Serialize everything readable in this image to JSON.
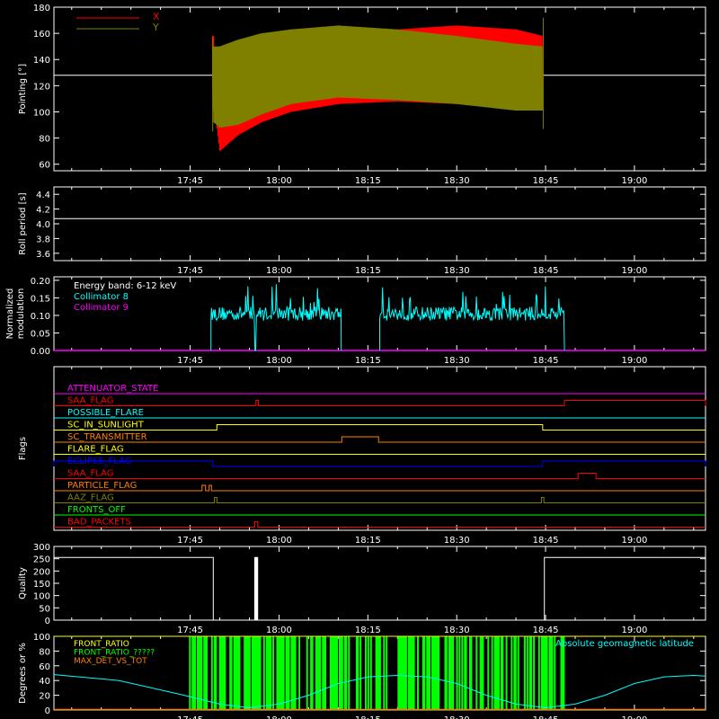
{
  "x_axis": {
    "tick_labels": [
      "17:45",
      "18:00",
      "18:15",
      "18:30",
      "18:45",
      "19:00"
    ],
    "tick_minutes": [
      45,
      60,
      75,
      90,
      105,
      120
    ],
    "range_minutes": [
      22,
      132
    ]
  },
  "colors": {
    "background": "#000000",
    "axes": "#ffffff",
    "red": "#ff0000",
    "olive": "#808000",
    "cyan": "#00ffff",
    "magenta": "#ff00ff",
    "yellow": "#ffff00",
    "orange": "#ff8000",
    "blue": "#0000ff",
    "green": "#00ff00"
  },
  "chart_data": [
    {
      "type": "line",
      "panel": "pointing",
      "ylabel": "Pointing [°]",
      "ylim": [
        55,
        180
      ],
      "yticks": [
        60,
        80,
        100,
        120,
        140,
        160,
        180
      ],
      "legend": [
        "X",
        "Y"
      ],
      "reference_line": 128,
      "series": [
        {
          "name": "X",
          "color": "#ff0000",
          "x_start": 48.8,
          "x_end": 104.5,
          "envelope": [
            [
              49,
              110,
              125
            ],
            [
              50,
              70,
              140
            ],
            [
              53,
              82,
              143
            ],
            [
              57,
              92,
              148
            ],
            [
              62,
              100,
              155
            ],
            [
              70,
              106,
              160
            ],
            [
              80,
              108,
              163
            ],
            [
              90,
              106,
              166
            ],
            [
              100,
              106,
              163
            ],
            [
              104.5,
              106,
              158
            ]
          ]
        },
        {
          "name": "Y",
          "color": "#808000",
          "x_start": 48.8,
          "x_end": 104.5,
          "envelope": [
            [
              49,
              92,
              150
            ],
            [
              50,
              88,
              150
            ],
            [
              53,
              90,
              155
            ],
            [
              57,
              98,
              160
            ],
            [
              62,
              106,
              163
            ],
            [
              70,
              111,
              166
            ],
            [
              80,
              109,
              163
            ],
            [
              90,
              106,
              158
            ],
            [
              100,
              101,
              152
            ],
            [
              104.5,
              101,
              150
            ]
          ]
        }
      ]
    },
    {
      "type": "line",
      "panel": "roll",
      "ylabel": "Roll period [s]",
      "ylim": [
        3.5,
        4.5
      ],
      "yticks": [
        3.6,
        3.8,
        4.0,
        4.2,
        4.4
      ],
      "series": [
        {
          "name": "",
          "color": "#ffffff",
          "x": [
            22,
            132
          ],
          "y": [
            4.07,
            4.07
          ]
        }
      ]
    },
    {
      "type": "line",
      "panel": "modulation",
      "ylabel": "Normalized modulation",
      "ylim": [
        0,
        0.21
      ],
      "yticks": [
        0.0,
        0.05,
        0.1,
        0.15,
        0.2
      ],
      "legend": [
        "Energy band: 6-12 keV",
        "Collimator 8",
        "Collimator 9"
      ],
      "series": [
        {
          "name": "Collimator 8",
          "color": "#00ffff",
          "segments": [
            [
              48.5,
              70.5
            ],
            [
              77,
              108.2
            ]
          ],
          "dropouts": [
            56
          ],
          "level": 0.105,
          "noise": 0.02
        },
        {
          "name": "Collimator 9",
          "color": "#ff00ff",
          "value": 0
        }
      ]
    },
    {
      "type": "line",
      "panel": "flags",
      "ylabel": "Flags",
      "flags": [
        {
          "name": "ATTENUATOR_STATE",
          "color": "#ff00ff",
          "segments": []
        },
        {
          "name": "SAA_FLAG",
          "color": "#ff0000",
          "segments": [
            [
              56.1,
              56.5
            ],
            [
              108.2,
              132
            ]
          ]
        },
        {
          "name": "POSSIBLE_FLARE",
          "color": "#00ffff",
          "segments": []
        },
        {
          "name": "SC_IN_SUNLIGHT",
          "color": "#ffff00",
          "segments": [
            [
              49.5,
              104.5
            ]
          ]
        },
        {
          "name": "SC_TRANSMITTER",
          "color": "#ff8000",
          "segments": [
            [
              70.6,
              76.8
            ]
          ]
        },
        {
          "name": "FLARE_FLAG",
          "color": "#ffff00",
          "segments": []
        },
        {
          "name": "ECLIPSE_FLAG",
          "color": "#0000ff",
          "segments": [
            [
              22,
              48.8
            ],
            [
              104.5,
              132
            ]
          ]
        },
        {
          "name": "SAA_FLAG",
          "color": "#ff0000",
          "segments": [
            [
              110.5,
              113.5
            ]
          ]
        },
        {
          "name": "PARTICLE_FLAG",
          "color": "#ff8000",
          "segments": [
            [
              47,
              47.6
            ],
            [
              48.2,
              48.6
            ]
          ]
        },
        {
          "name": "AAZ_FLAG",
          "color": "#808000",
          "segments": [
            [
              49.1,
              49.5
            ],
            [
              104.3,
              104.7
            ]
          ]
        },
        {
          "name": "FRONTS_OFF",
          "color": "#00ff00",
          "segments": []
        },
        {
          "name": "BAD_PACKETS",
          "color": "#ff0000",
          "segments": [
            [
              55.9,
              56.4
            ]
          ]
        }
      ]
    },
    {
      "type": "line",
      "panel": "quality",
      "ylabel": "Quality",
      "ylim": [
        0,
        300
      ],
      "yticks": [
        0,
        50,
        100,
        150,
        200,
        250,
        300
      ],
      "series": [
        {
          "name": "",
          "color": "#ffffff",
          "x": [
            22,
            48.9,
            48.9,
            55.9,
            55.9,
            56.4,
            56.4,
            104.8,
            104.8,
            132
          ],
          "y": [
            255,
            255,
            0,
            0,
            255,
            255,
            0,
            0,
            255,
            255
          ]
        }
      ]
    },
    {
      "type": "area",
      "panel": "fronts",
      "ylabel": "Degrees or %",
      "ylim": [
        0,
        100
      ],
      "yticks": [
        0,
        20,
        40,
        60,
        80,
        100
      ],
      "legend": [
        "FRONT_RATIO",
        "FRONT_RATIO_?????",
        "MAX_DET_VS_TOT",
        "Absolute geomagnetic latitude"
      ],
      "series": [
        {
          "name": "FRONT_RATIO",
          "color": "#ffff00",
          "value": 100
        },
        {
          "name": "FRONT_RATIO_?????",
          "color": "#00ff00",
          "x_start": 44.8,
          "x_end": 108
        },
        {
          "name": "MAX_DET_VS_TOT",
          "color": "#ff8000",
          "value": 0
        },
        {
          "name": "Absolute geomagnetic latitude",
          "color": "#00ffff",
          "x": [
            22,
            33,
            44,
            50,
            55,
            60,
            65,
            70,
            75,
            80,
            85,
            90,
            95,
            100,
            105,
            110,
            115,
            120,
            125,
            130,
            132
          ],
          "y": [
            48,
            40,
            20,
            8,
            3,
            8,
            20,
            36,
            45,
            47,
            45,
            36,
            20,
            8,
            3,
            8,
            20,
            36,
            45,
            47,
            46
          ]
        }
      ]
    }
  ]
}
